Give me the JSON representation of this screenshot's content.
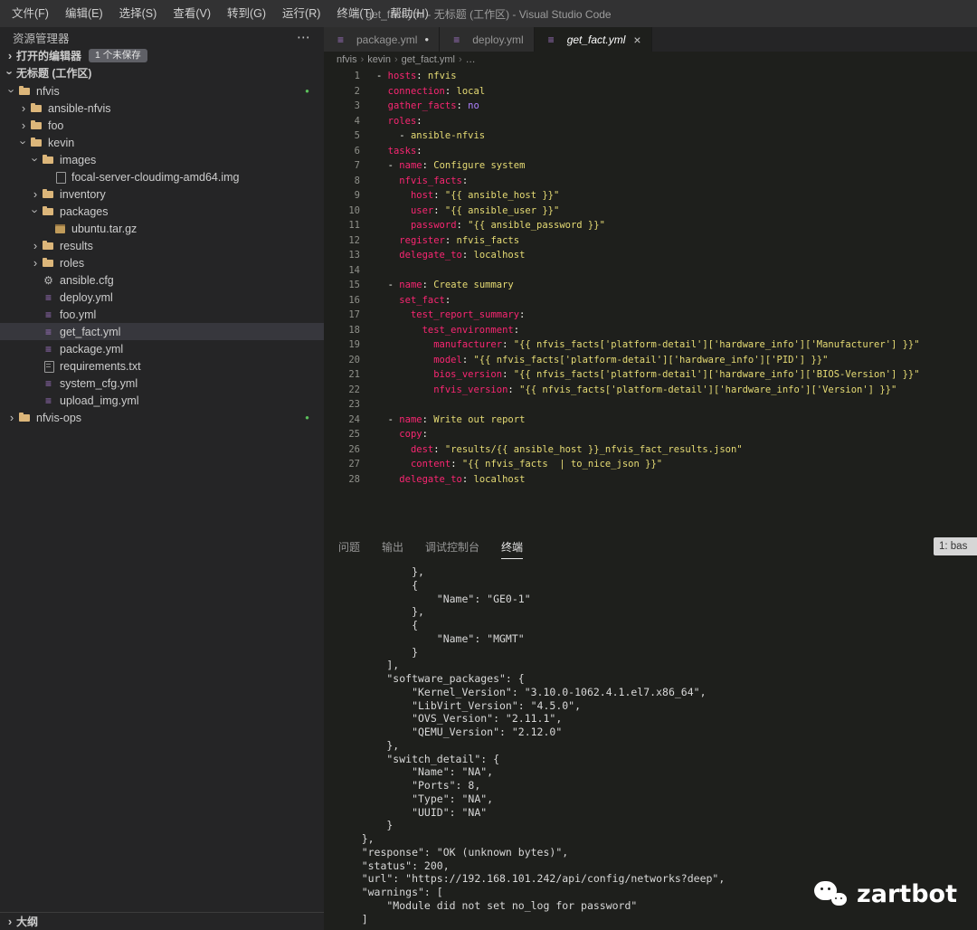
{
  "window": {
    "menus": [
      "文件(F)",
      "编辑(E)",
      "选择(S)",
      "查看(V)",
      "转到(G)",
      "运行(R)",
      "终端(T)",
      "帮助(H)"
    ],
    "title": "get_fact.yml - 无标题 (工作区) - Visual Studio Code"
  },
  "icons": {
    "chevron": "›",
    "yaml": "≡",
    "gear": "⚙",
    "modified_dot": "●",
    "close": "×",
    "more": "⋯"
  },
  "colors": {
    "c-key": "#f92672",
    "c-str": "#e6db74",
    "c-const": "#ae81ff",
    "c-plain": "#f8f8f2",
    "c-green": "#5bbf5b",
    "c-folder": "#dcb67a",
    "c-yml": "#a074c4"
  },
  "sidebar": {
    "header": "资源管理器",
    "open_editors": {
      "label": "打开的编辑器",
      "badge": "1 个未保存"
    },
    "workspace_label": "无标题 (工作区)",
    "outline_label": "大纲",
    "tree": [
      {
        "label": "nfvis",
        "type": "folder",
        "level": 0,
        "expanded": true,
        "dot": true
      },
      {
        "label": "ansible-nfvis",
        "type": "folder",
        "level": 1
      },
      {
        "label": "foo",
        "type": "folder",
        "level": 1
      },
      {
        "label": "kevin",
        "type": "folder",
        "level": 1,
        "expanded": true
      },
      {
        "label": "images",
        "type": "folder",
        "level": 2,
        "expanded": true
      },
      {
        "label": "focal-server-cloudimg-amd64.img",
        "type": "file",
        "level": 3
      },
      {
        "label": "inventory",
        "type": "folder",
        "level": 2
      },
      {
        "label": "packages",
        "type": "folder",
        "level": 2,
        "expanded": true
      },
      {
        "label": "ubuntu.tar.gz",
        "type": "zip",
        "level": 3
      },
      {
        "label": "results",
        "type": "folder",
        "level": 2
      },
      {
        "label": "roles",
        "type": "folder",
        "level": 2
      },
      {
        "label": "ansible.cfg",
        "type": "gear",
        "level": 2
      },
      {
        "label": "deploy.yml",
        "type": "yml",
        "level": 2
      },
      {
        "label": "foo.yml",
        "type": "yml",
        "level": 2
      },
      {
        "label": "get_fact.yml",
        "type": "yml",
        "level": 2,
        "selected": true
      },
      {
        "label": "package.yml",
        "type": "yml",
        "level": 2
      },
      {
        "label": "requirements.txt",
        "type": "txt",
        "level": 2
      },
      {
        "label": "system_cfg.yml",
        "type": "yml",
        "level": 2
      },
      {
        "label": "upload_img.yml",
        "type": "yml",
        "level": 2
      },
      {
        "label": "nfvis-ops",
        "type": "folder",
        "level": 0,
        "dot": true
      }
    ]
  },
  "tabs": [
    {
      "label": "package.yml",
      "state": "modified"
    },
    {
      "label": "deploy.yml",
      "state": "normal"
    },
    {
      "label": "get_fact.yml",
      "state": "active"
    }
  ],
  "breadcrumb": [
    "nfvis",
    "kevin",
    "get_fact.yml",
    "…"
  ],
  "editor": {
    "lines": [
      [
        [
          "p",
          "- "
        ],
        [
          "k",
          "hosts"
        ],
        [
          "p",
          ": "
        ],
        [
          "s",
          "nfvis"
        ]
      ],
      [
        [
          "p",
          "  "
        ],
        [
          "k",
          "connection"
        ],
        [
          "p",
          ": "
        ],
        [
          "s",
          "local"
        ]
      ],
      [
        [
          "p",
          "  "
        ],
        [
          "k",
          "gather_facts"
        ],
        [
          "p",
          ": "
        ],
        [
          "c",
          "no"
        ]
      ],
      [
        [
          "p",
          "  "
        ],
        [
          "k",
          "roles"
        ],
        [
          "p",
          ":"
        ]
      ],
      [
        [
          "p",
          "    - "
        ],
        [
          "s",
          "ansible-nfvis"
        ]
      ],
      [
        [
          "p",
          "  "
        ],
        [
          "k",
          "tasks"
        ],
        [
          "p",
          ":"
        ]
      ],
      [
        [
          "p",
          "  - "
        ],
        [
          "k",
          "name"
        ],
        [
          "p",
          ": "
        ],
        [
          "s",
          "Configure system"
        ]
      ],
      [
        [
          "p",
          "    "
        ],
        [
          "k",
          "nfvis_facts"
        ],
        [
          "p",
          ":"
        ]
      ],
      [
        [
          "p",
          "      "
        ],
        [
          "k",
          "host"
        ],
        [
          "p",
          ": "
        ],
        [
          "s",
          "\"{{ ansible_host }}\""
        ]
      ],
      [
        [
          "p",
          "      "
        ],
        [
          "k",
          "user"
        ],
        [
          "p",
          ": "
        ],
        [
          "s",
          "\"{{ ansible_user }}\""
        ]
      ],
      [
        [
          "p",
          "      "
        ],
        [
          "k",
          "password"
        ],
        [
          "p",
          ": "
        ],
        [
          "s",
          "\"{{ ansible_password }}\""
        ]
      ],
      [
        [
          "p",
          "    "
        ],
        [
          "k",
          "register"
        ],
        [
          "p",
          ": "
        ],
        [
          "s",
          "nfvis_facts"
        ]
      ],
      [
        [
          "p",
          "    "
        ],
        [
          "k",
          "delegate_to"
        ],
        [
          "p",
          ": "
        ],
        [
          "s",
          "localhost"
        ]
      ],
      [],
      [
        [
          "p",
          "  - "
        ],
        [
          "k",
          "name"
        ],
        [
          "p",
          ": "
        ],
        [
          "s",
          "Create summary"
        ]
      ],
      [
        [
          "p",
          "    "
        ],
        [
          "k",
          "set_fact"
        ],
        [
          "p",
          ":"
        ]
      ],
      [
        [
          "p",
          "      "
        ],
        [
          "k",
          "test_report_summary"
        ],
        [
          "p",
          ":"
        ]
      ],
      [
        [
          "p",
          "        "
        ],
        [
          "k",
          "test_environment"
        ],
        [
          "p",
          ":"
        ]
      ],
      [
        [
          "p",
          "          "
        ],
        [
          "k",
          "manufacturer"
        ],
        [
          "p",
          ": "
        ],
        [
          "s",
          "\"{{ nfvis_facts['platform-detail']['hardware_info']['Manufacturer'] }}\""
        ]
      ],
      [
        [
          "p",
          "          "
        ],
        [
          "k",
          "model"
        ],
        [
          "p",
          ": "
        ],
        [
          "s",
          "\"{{ nfvis_facts['platform-detail']['hardware_info']['PID'] }}\""
        ]
      ],
      [
        [
          "p",
          "          "
        ],
        [
          "k",
          "bios_version"
        ],
        [
          "p",
          ": "
        ],
        [
          "s",
          "\"{{ nfvis_facts['platform-detail']['hardware_info']['BIOS-Version'] }}\""
        ]
      ],
      [
        [
          "p",
          "          "
        ],
        [
          "k",
          "nfvis_version"
        ],
        [
          "p",
          ": "
        ],
        [
          "s",
          "\"{{ nfvis_facts['platform-detail']['hardware_info']['Version'] }}\""
        ]
      ],
      [],
      [
        [
          "p",
          "  - "
        ],
        [
          "k",
          "name"
        ],
        [
          "p",
          ": "
        ],
        [
          "s",
          "Write out report"
        ]
      ],
      [
        [
          "p",
          "    "
        ],
        [
          "k",
          "copy"
        ],
        [
          "p",
          ":"
        ]
      ],
      [
        [
          "p",
          "      "
        ],
        [
          "k",
          "dest"
        ],
        [
          "p",
          ": "
        ],
        [
          "s",
          "\"results/{{ ansible_host }}_nfvis_fact_results.json\""
        ]
      ],
      [
        [
          "p",
          "      "
        ],
        [
          "k",
          "content"
        ],
        [
          "p",
          ": "
        ],
        [
          "s",
          "\"{{ nfvis_facts  | to_nice_json }}\""
        ]
      ],
      [
        [
          "p",
          "    "
        ],
        [
          "k",
          "delegate_to"
        ],
        [
          "p",
          ": "
        ],
        [
          "s",
          "localhost"
        ]
      ]
    ]
  },
  "panel": {
    "tabs": [
      "问题",
      "输出",
      "调试控制台",
      "终端"
    ],
    "active": "终端",
    "terminal_selector": "1: bas",
    "terminal_lines": [
      "            },",
      "            {",
      "                \"Name\": \"GE0-1\"",
      "            },",
      "            {",
      "                \"Name\": \"MGMT\"",
      "            }",
      "        ],",
      "        \"software_packages\": {",
      "            \"Kernel_Version\": \"3.10.0-1062.4.1.el7.x86_64\",",
      "            \"LibVirt_Version\": \"4.5.0\",",
      "            \"OVS_Version\": \"2.11.1\",",
      "            \"QEMU_Version\": \"2.12.0\"",
      "        },",
      "        \"switch_detail\": {",
      "            \"Name\": \"NA\",",
      "            \"Ports\": 8,",
      "            \"Type\": \"NA\",",
      "            \"UUID\": \"NA\"",
      "        }",
      "    },",
      "    \"response\": \"OK (unknown bytes)\",",
      "    \"status\": 200,",
      "    \"url\": \"https://192.168.101.242/api/config/networks?deep\",",
      "    \"warnings\": [",
      "        \"Module did not set no_log for password\"",
      "    ]"
    ]
  },
  "watermark": {
    "text": "zartbot"
  }
}
